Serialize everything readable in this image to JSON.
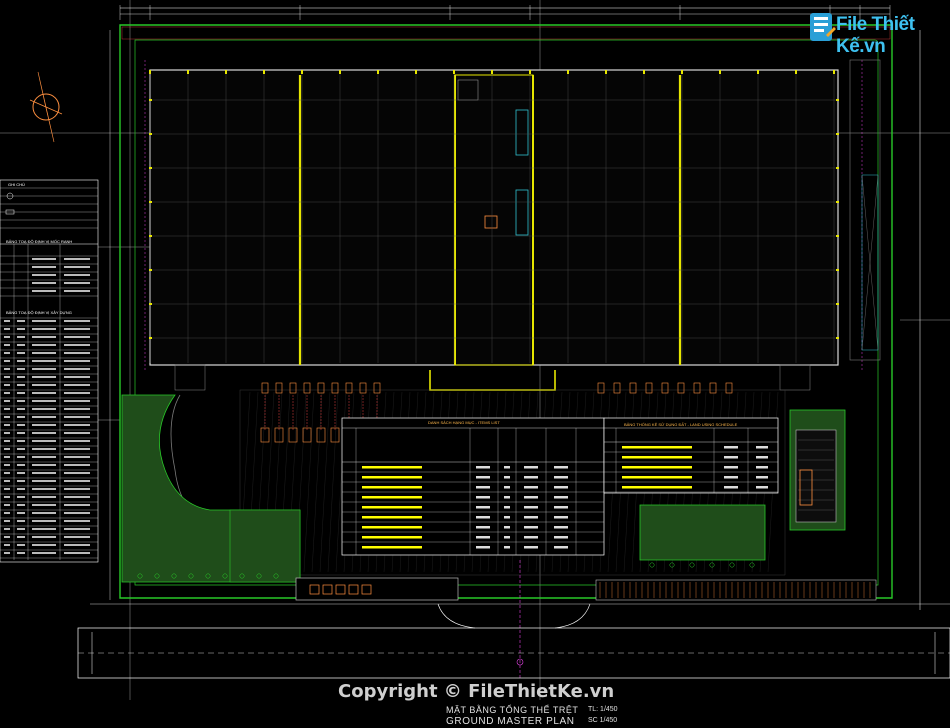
{
  "logo": {
    "text": "File Thiết Kế.vn",
    "icon": "file-logo-icon"
  },
  "watermark": {
    "copyright": "Copyright © FileThietKe.vn"
  },
  "drawing_title": {
    "vietnamese": "MẶT BẰNG TỔNG THỂ TRỆT",
    "english": "GROUND MASTER PLAN",
    "scale_1": "TL: 1/450",
    "scale_2": "SC 1/450"
  },
  "colors": {
    "background": "#000000",
    "site_boundary": "#28c828",
    "building_column": "#e6e600",
    "grid_lines": "#5a5a5a",
    "dimension_lines": "#ffffff",
    "landscape": "#1f4d1a",
    "table_border": "#ffffff",
    "highlight_text": "#ffff00",
    "magenta_marks": "#e040e0",
    "orange_marks": "#ff9040",
    "cyan_marks": "#30c0d0",
    "red_marks": "#e04040",
    "copyright_text": "#cfcfcf",
    "logo_blue": "#3ec1f0"
  },
  "north_arrow": {
    "icon": "north-arrow-icon"
  },
  "left_tables": {
    "legend_heading": "GHI CHÚ",
    "coord_heading_1": "BẢNG TOẠ ĐỘ ĐỊNH VỊ MỐC RANH",
    "coord_heading_2": "BẢNG TOẠ ĐỘ ĐỊNH VỊ XÂY DỰNG"
  },
  "center_tables": {
    "items_title": "DANH SÁCH HẠNG MỤC - ITEMS LIST",
    "land_title": "BẢNG THỐNG KÊ SỬ DỤNG ĐẤT - LAND USING SCHEDULE"
  }
}
